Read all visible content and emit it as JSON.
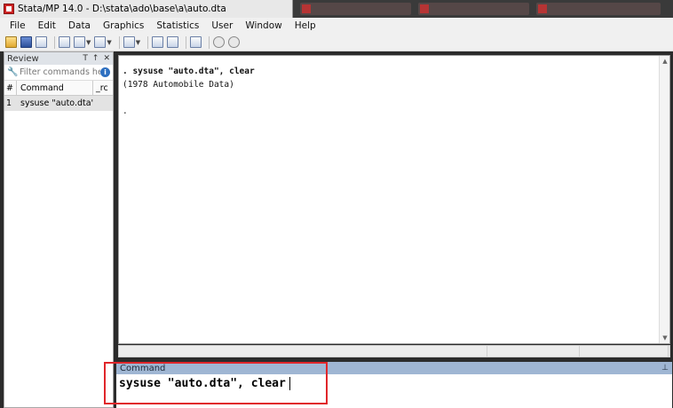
{
  "window": {
    "title": "Stata/MP 14.0 - D:\\stata\\ado\\base\\a\\auto.dta"
  },
  "menu": [
    "File",
    "Edit",
    "Data",
    "Graphics",
    "Statistics",
    "User",
    "Window",
    "Help"
  ],
  "review": {
    "title": "Review",
    "controls": [
      "T",
      "↑",
      "✕"
    ],
    "filter_placeholder": "Filter commands he",
    "columns": [
      "#",
      "Command",
      "_rc"
    ],
    "rows": [
      {
        "num": "1",
        "command": "sysuse \"auto.dta\",...",
        "rc": ""
      }
    ]
  },
  "results": {
    "lines": [
      ". sysuse \"auto.dta\", clear",
      "(1978 Automobile Data)",
      "",
      "."
    ]
  },
  "command": {
    "title": "Command",
    "value": "sysuse \"auto.dta\", clear"
  },
  "colors": {
    "highlight": "#e0262a",
    "command_header": "#9fb6d3"
  }
}
